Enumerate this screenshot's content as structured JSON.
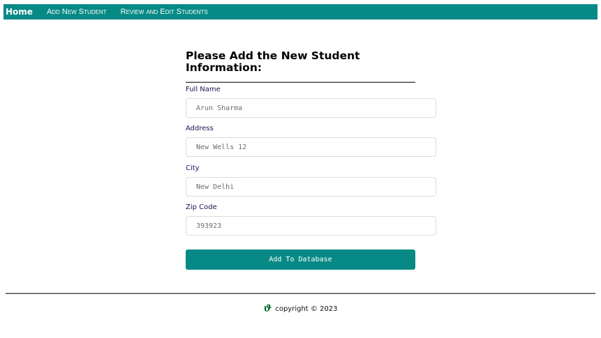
{
  "nav": {
    "home": "Home",
    "links": [
      "Add New Student",
      "Review and Edit Students"
    ]
  },
  "form": {
    "title": "Please Add the New Student Information:",
    "fields": [
      {
        "label": "Full Name",
        "placeholder": "Arun Sharma"
      },
      {
        "label": "Address",
        "placeholder": "New Wells 12"
      },
      {
        "label": "City",
        "placeholder": "New Delhi"
      },
      {
        "label": "Zip Code",
        "placeholder": "393923"
      }
    ],
    "submit_label": "Add To Database"
  },
  "footer": {
    "logo_icon": "leaf-logo-icon",
    "copyright": "copyright © 2023"
  },
  "colors": {
    "accent": "#078a85",
    "label": "#16164f"
  }
}
